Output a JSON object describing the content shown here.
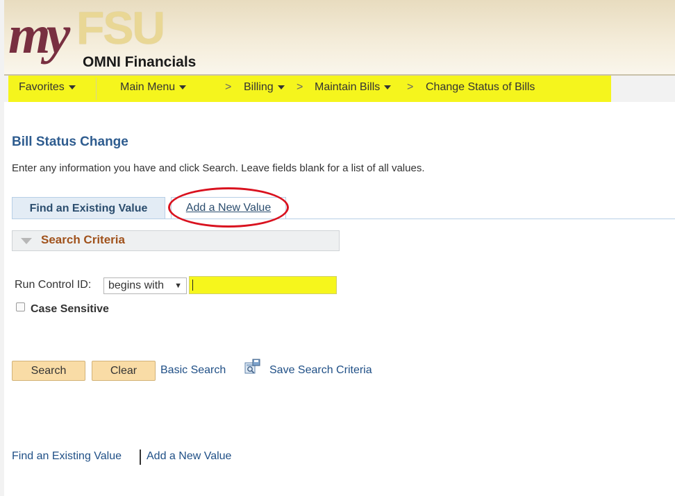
{
  "header": {
    "logo_my": "my",
    "logo_fsu": "FSU",
    "app_name": "OMNI Financials"
  },
  "nav": {
    "favorites": "Favorites",
    "main_menu": "Main Menu",
    "separator": ">",
    "billing": "Billing",
    "maintain_bills": "Maintain Bills",
    "current": "Change Status of Bills"
  },
  "page": {
    "title": "Bill Status Change",
    "instructions": "Enter any information you have and click Search. Leave fields blank for a list of all values."
  },
  "tabs": {
    "find": "Find an Existing Value",
    "add_first_letter": "A",
    "add_rest": "dd a New Value"
  },
  "search": {
    "criteria_label": "Search Criteria",
    "run_control_label": "Run Control ID:",
    "operator": "begins with",
    "operator_arrow": "▼",
    "value": "",
    "case_sensitive_label": "Case Sensitive",
    "case_sensitive_checked": false
  },
  "actions": {
    "search": "Search",
    "clear": "Clear",
    "basic_search": "Basic Search",
    "save_criteria": "Save Search Criteria"
  },
  "footer": {
    "find_link": "Find an Existing Value",
    "add_link": "Add a New Value"
  },
  "colors": {
    "highlight": "#f5f51d",
    "annotation": "#d9121f",
    "title": "#2e5c8f",
    "criteria": "#a0521c",
    "button": "#f9dca6",
    "brand_garnet": "#782f40",
    "brand_gold": "#e9d795"
  }
}
